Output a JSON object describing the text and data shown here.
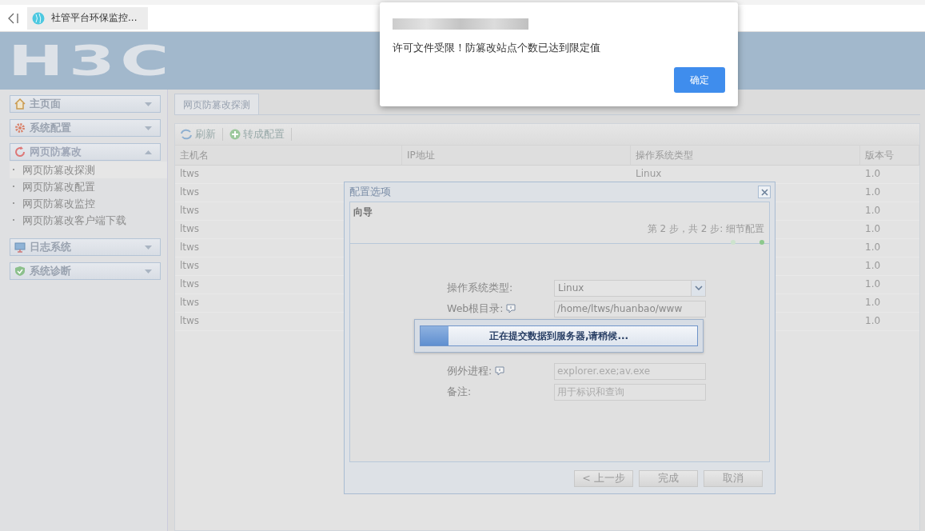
{
  "browser_tab": {
    "title": "社管平台环保监控..."
  },
  "header": {
    "logo": "H3C"
  },
  "sidebar": {
    "panels": [
      {
        "title": "主页面",
        "kind": "home",
        "expanded": false
      },
      {
        "title": "系统配置",
        "kind": "gear",
        "expanded": false
      },
      {
        "title": "网页防篡改",
        "kind": "refresh",
        "expanded": true,
        "items": [
          {
            "label": "网页防篡改探测",
            "selected": true
          },
          {
            "label": "网页防篡改配置",
            "selected": false
          },
          {
            "label": "网页防篡改监控",
            "selected": false
          },
          {
            "label": "网页防篡改客户端下载",
            "selected": false
          }
        ]
      },
      {
        "title": "日志系统",
        "kind": "monitor",
        "expanded": false
      },
      {
        "title": "系统诊断",
        "kind": "shield",
        "expanded": false
      }
    ]
  },
  "tabs": [
    {
      "label": "网页防篡改探测"
    }
  ],
  "toolbar": [
    {
      "label": "刷新",
      "kind": "refresh"
    },
    {
      "label": "转成配置",
      "kind": "plus"
    }
  ],
  "table": {
    "columns": [
      "主机名",
      "IP地址",
      "操作系统类型",
      "版本号"
    ],
    "rows": [
      {
        "host": "ltws",
        "os": "Linux",
        "version": "1.0"
      },
      {
        "host": "ltws",
        "version": "1.0"
      },
      {
        "host": "ltws",
        "version": "1.0"
      },
      {
        "host": "ltws",
        "version": "1.0"
      },
      {
        "host": "ltws",
        "version": "1.0"
      },
      {
        "host": "ltws",
        "version": "1.0"
      },
      {
        "host": "ltws",
        "version": "1.0"
      },
      {
        "host": "ltws",
        "version": "1.0"
      },
      {
        "host": "ltws",
        "version": "1.0"
      }
    ]
  },
  "config_dialog": {
    "title": "配置选项",
    "wizard_title": "向导",
    "step": "第 2 步，共 2 步: 细节配置",
    "steps": [
      {
        "selected": false
      },
      {
        "selected": true
      }
    ],
    "fields": [
      {
        "kind": "select",
        "label": "操作系统类型:",
        "value": "Linux"
      },
      {
        "kind": "text",
        "label": "Web根目录:",
        "info": true,
        "value": "/home/ltws/huanbao/www"
      },
      {
        "kind": "hidden"
      },
      {
        "kind": "hidden"
      },
      {
        "kind": "text",
        "label": "例外进程:",
        "info": true,
        "placeholder": "explorer.exe;av.exe"
      },
      {
        "kind": "text",
        "label": "备注:",
        "info": false,
        "placeholder": "用于标识和查询"
      }
    ],
    "buttons": [
      "< 上一步",
      "完成",
      "取消"
    ]
  },
  "progress": {
    "message": "正在提交数据到服务器,请稍候...",
    "level": 0.1
  },
  "alert": {
    "message": "许可文件受限！防篡改站点个数已达到限定值",
    "button": "确定"
  }
}
